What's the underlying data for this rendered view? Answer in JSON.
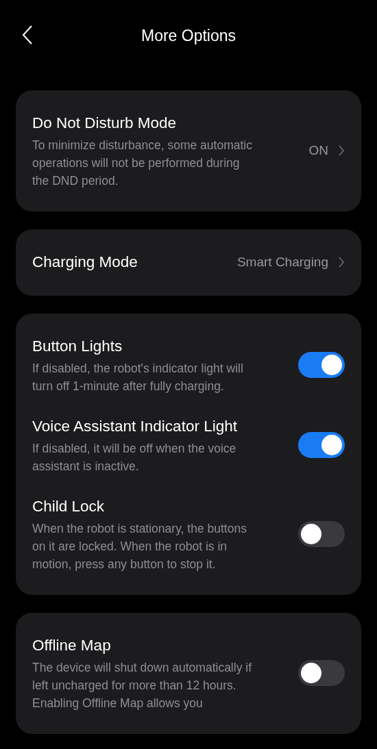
{
  "header": {
    "title": "More Options"
  },
  "cards": [
    {
      "items": [
        {
          "kind": "link",
          "title": "Do Not Disturb Mode",
          "description": "To minimize disturbance, some automatic operations will not be performed during the DND period.",
          "value": "ON"
        }
      ]
    },
    {
      "items": [
        {
          "kind": "link",
          "title": "Charging Mode",
          "value": "Smart Charging"
        }
      ]
    },
    {
      "items": [
        {
          "kind": "toggle",
          "title": "Button Lights",
          "description": "If disabled, the robot's indicator light will turn off 1-minute after fully charging.",
          "on": true
        },
        {
          "kind": "toggle",
          "title": "Voice Assistant Indicator Light",
          "description": "If disabled, it will be off when the voice assistant is inactive.",
          "on": true
        },
        {
          "kind": "toggle",
          "title": "Child Lock",
          "description": "When the robot is stationary, the buttons on it are locked. When the robot is in motion, press any button to stop it.",
          "on": false
        }
      ]
    },
    {
      "items": [
        {
          "kind": "toggle",
          "title": "Offline Map",
          "description": "The device will shut down automatically if left uncharged for more than 12 hours. Enabling Offline Map allows you",
          "on": false
        }
      ]
    }
  ]
}
